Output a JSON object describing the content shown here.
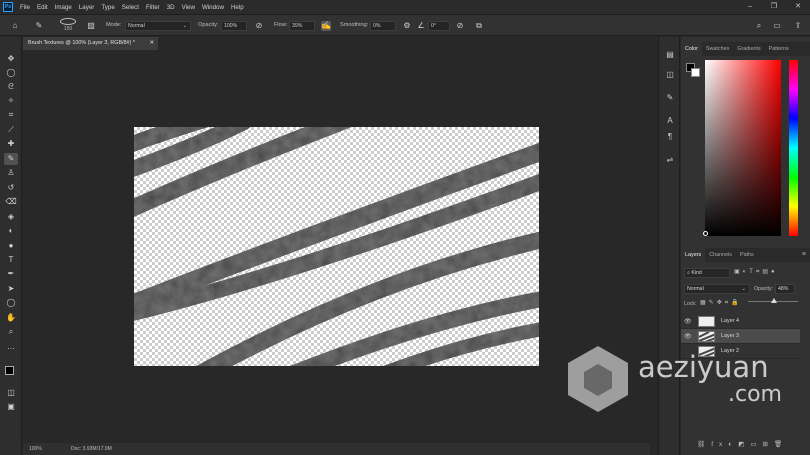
{
  "menu": [
    "File",
    "Edit",
    "Image",
    "Layer",
    "Type",
    "Select",
    "Filter",
    "3D",
    "View",
    "Window",
    "Help"
  ],
  "options": {
    "brush_size": "150",
    "mode_label": "Mode:",
    "mode_value": "Normal",
    "opacity_label": "Opacity:",
    "opacity_value": "100%",
    "flow_label": "Flow:",
    "flow_value": "39%",
    "smoothing_label": "Smoothing:",
    "smoothing_value": "0%",
    "angle_value": "0°"
  },
  "document": {
    "tab_title": "Brush Textures @ 100% (Layer 3, RGB/8#) *",
    "zoom": "100%",
    "doc_info": "Doc: 3.93M/17.9M"
  },
  "color_panel": {
    "tabs": [
      "Color",
      "Swatches",
      "Gradients",
      "Patterns"
    ]
  },
  "layers_panel": {
    "tabs": [
      "Layers",
      "Channels",
      "Paths"
    ],
    "kind_label": "Kind",
    "blend_mode": "Normal",
    "opacity_label": "Opacity:",
    "opacity_value": "48%",
    "lock_label": "Lock:",
    "layers": [
      {
        "name": "Layer 4",
        "visible": true
      },
      {
        "name": "Layer 3",
        "visible": true,
        "selected": true
      },
      {
        "name": "Layer 2",
        "visible": false
      }
    ]
  },
  "watermark": {
    "line1": "aeziyuan",
    "line2": ".com"
  }
}
